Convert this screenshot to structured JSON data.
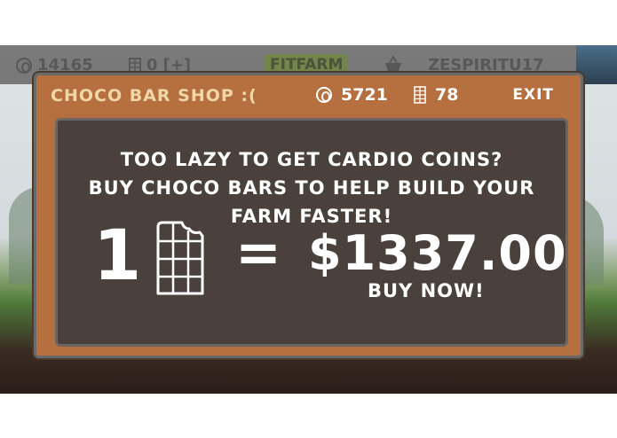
{
  "hud": {
    "coins": "14165",
    "bars": "0",
    "add_label": "[+]",
    "logo": "FITFARM",
    "username": "ZESPIRITU17"
  },
  "shop": {
    "title": "CHOCO BAR SHOP :(",
    "coins": "5721",
    "bars": "78",
    "exit_label": "EXIT",
    "message_lines": [
      "TOO LAZY TO GET CARDIO COINS?",
      "BUY CHOCO BARS TO HELP BUILD YOUR",
      "FARM FASTER!"
    ],
    "offer": {
      "quantity": "1",
      "equals": "=",
      "price": "$1337.00",
      "buy_label": "BUY NOW!"
    }
  },
  "icons": {
    "coin": "coin-icon",
    "choco_bar": "choco-bar-icon",
    "basket": "basket-icon"
  },
  "colors": {
    "modal": "#b6703f",
    "panel": "#4a403c",
    "title": "#f2d7a8"
  }
}
